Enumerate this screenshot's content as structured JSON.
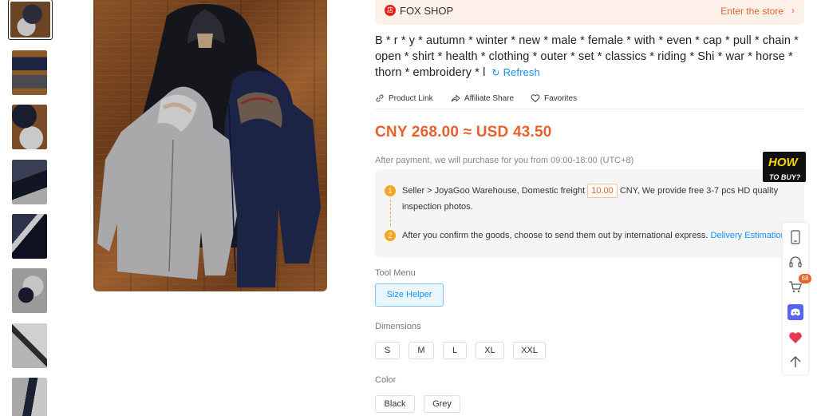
{
  "thumbnails": [
    {
      "name": "thumb-1",
      "colors": [
        "#6b4423",
        "#2b2d3a",
        "#bfbfbf"
      ]
    },
    {
      "name": "thumb-2",
      "colors": [
        "#8b5a2b",
        "#1f2440",
        "#4a4a55"
      ]
    },
    {
      "name": "thumb-3",
      "colors": [
        "#7a4b26",
        "#1a1d2e",
        "#c9c9c9"
      ]
    },
    {
      "name": "thumb-4",
      "colors": [
        "#3a3f55",
        "#111524",
        "#a8a8a8"
      ]
    },
    {
      "name": "thumb-5",
      "colors": [
        "#2c3248",
        "#0e1220",
        "#c8c8c8"
      ]
    },
    {
      "name": "thumb-6",
      "colors": [
        "#9a9a9a",
        "#15192a",
        "#c5c5c5"
      ]
    },
    {
      "name": "thumb-7",
      "colors": [
        "#b5b5b5",
        "#2a2a2a",
        "#d0d0d0"
      ]
    },
    {
      "name": "thumb-8",
      "colors": [
        "#a8a8a8",
        "#1a2133",
        "#c8c8c8"
      ]
    }
  ],
  "shop": {
    "logo_text": "店",
    "name": "FOX SHOP",
    "enter_label": "Enter the store",
    "chevron": "›"
  },
  "product": {
    "title": "B * r * y * autumn * winter * new * male * female * with * even * cap * pull * chain * open * shirt * health * clothing * outer * set * classics * riding * Shi * war * horse * thorn * embroidery * l",
    "refresh_label": "Refresh",
    "price": "CNY 268.00 ≈ USD 43.50"
  },
  "actions": {
    "product_link": "Product Link",
    "affiliate_share": "Affiliate Share",
    "favorites": "Favorites"
  },
  "purchase_note": "After payment, we will purchase for you from 09:00-18:00 (UTC+8)",
  "how_to_buy": {
    "line1": "HOW",
    "line2": "TO BUY?"
  },
  "steps": {
    "step1_num": "1",
    "step1_prefix": "Seller > JoyaGoo Warehouse, Domestic freight",
    "freight_value": "10.00",
    "step1_suffix": "CNY, We provide free 3-7 pcs HD quality inspection photos.",
    "step2_num": "2",
    "step2_text": "After you confirm the goods, choose to send them out by international express.",
    "delivery_link": "Delivery Estimation >"
  },
  "tool_menu": {
    "label": "Tool Menu",
    "size_helper": "Size Helper"
  },
  "dimensions": {
    "label": "Dimensions",
    "options": [
      "S",
      "M",
      "L",
      "XL",
      "XXL"
    ]
  },
  "color": {
    "label": "Color",
    "options": [
      "Black",
      "Grey"
    ]
  },
  "toolbar": {
    "cart_count": "68"
  },
  "colors": {
    "accent": "#e8612c",
    "link": "#1890ff",
    "step": "#f5a623",
    "discord": "#5865f2",
    "heart": "#e8384f"
  }
}
